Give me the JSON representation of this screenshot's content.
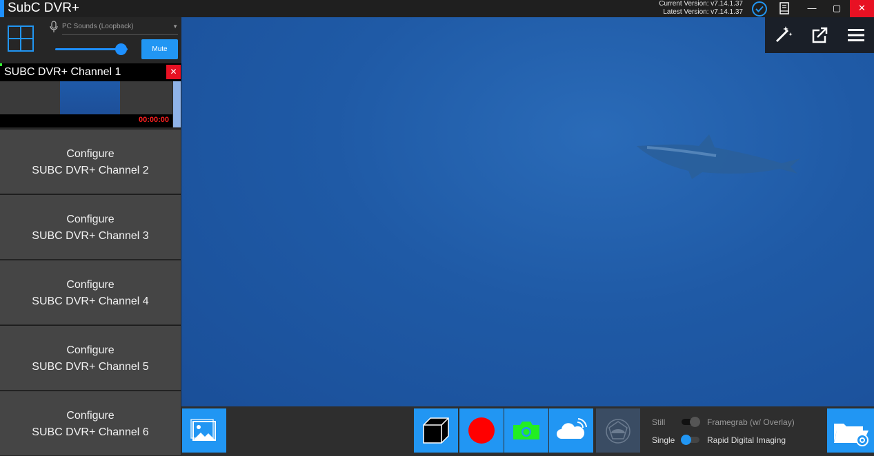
{
  "titlebar": {
    "app_title": "SubC DVR+",
    "current_version": "Current Version: v7.14.1.37",
    "latest_version": "Latest Version: v7.14.1.37",
    "minimize": "—",
    "maximize": "▢",
    "close": "✕"
  },
  "audio": {
    "source": "PC Sounds (Loopback)",
    "volume_percent": 90,
    "mute_label": "Mute"
  },
  "channel1": {
    "title": "SUBC DVR+ Channel 1",
    "close": "✕",
    "time": "00:00:00"
  },
  "configure": [
    {
      "line1": "Configure",
      "line2": "SUBC DVR+ Channel 2"
    },
    {
      "line1": "Configure",
      "line2": "SUBC DVR+ Channel 3"
    },
    {
      "line1": "Configure",
      "line2": "SUBC DVR+ Channel 4"
    },
    {
      "line1": "Configure",
      "line2": "SUBC DVR+ Channel 5"
    },
    {
      "line1": "Configure",
      "line2": "SUBC DVR+ Channel 6"
    }
  ],
  "capture_options": {
    "still": "Still",
    "framegrab": "Framegrab (w/ Overlay)",
    "single": "Single",
    "rdi": "Rapid Digital Imaging"
  },
  "colors": {
    "accent": "#2196f3",
    "close_red": "#e81123",
    "record_red": "#ff0000",
    "camera_green": "#22ee22"
  }
}
